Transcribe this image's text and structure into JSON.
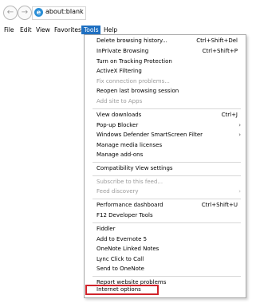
{
  "address_bar": {
    "url": "about:blank",
    "back_glyph": "←",
    "forward_glyph": "→",
    "site_icon_glyph": "e"
  },
  "menubar": {
    "items": [
      "File",
      "Edit",
      "View",
      "Favorites",
      "Tools",
      "Help"
    ],
    "active": "Tools"
  },
  "tools_menu": {
    "groups": [
      [
        {
          "label": "Delete browsing history...",
          "shortcut": "Ctrl+Shift+Del",
          "enabled": true
        },
        {
          "label": "InPrivate Browsing",
          "shortcut": "Ctrl+Shift+P",
          "enabled": true
        },
        {
          "label": "Turn on Tracking Protection",
          "shortcut": "",
          "enabled": true
        },
        {
          "label": "ActiveX Filtering",
          "shortcut": "",
          "enabled": true
        },
        {
          "label": "Fix connection problems...",
          "shortcut": "",
          "enabled": false
        },
        {
          "label": "Reopen last browsing session",
          "shortcut": "",
          "enabled": true
        },
        {
          "label": "Add site to Apps",
          "shortcut": "",
          "enabled": false
        }
      ],
      [
        {
          "label": "View downloads",
          "shortcut": "Ctrl+J",
          "enabled": true
        },
        {
          "label": "Pop-up Blocker",
          "submenu": true,
          "enabled": true
        },
        {
          "label": "Windows Defender SmartScreen Filter",
          "submenu": true,
          "enabled": true
        },
        {
          "label": "Manage media licenses",
          "shortcut": "",
          "enabled": true
        },
        {
          "label": "Manage add-ons",
          "shortcut": "",
          "enabled": true
        }
      ],
      [
        {
          "label": "Compatibility View settings",
          "shortcut": "",
          "enabled": true
        }
      ],
      [
        {
          "label": "Subscribe to this feed...",
          "shortcut": "",
          "enabled": false
        },
        {
          "label": "Feed discovery",
          "submenu": true,
          "enabled": false
        }
      ],
      [
        {
          "label": "Performance dashboard",
          "shortcut": "Ctrl+Shift+U",
          "enabled": true
        },
        {
          "label": "F12 Developer Tools",
          "shortcut": "",
          "enabled": true
        }
      ],
      [
        {
          "label": "Fiddler",
          "shortcut": "",
          "enabled": true
        },
        {
          "label": "Add to Evernote 5",
          "shortcut": "",
          "enabled": true
        },
        {
          "label": "OneNote Linked Notes",
          "shortcut": "",
          "enabled": true
        },
        {
          "label": "Lync Click to Call",
          "shortcut": "",
          "enabled": true
        },
        {
          "label": "Send to OneNote",
          "shortcut": "",
          "enabled": true
        }
      ],
      [
        {
          "label": "Report website problems",
          "shortcut": "",
          "enabled": true
        },
        {
          "label": "Internet options",
          "shortcut": "",
          "enabled": true,
          "highlighted": true
        }
      ]
    ],
    "submenu_arrow_glyph": "›",
    "highlight_color": "#d0232a"
  },
  "colors": {
    "menubar_active_bg": "#1e6fc1",
    "disabled_text": "#9b9b9b"
  }
}
